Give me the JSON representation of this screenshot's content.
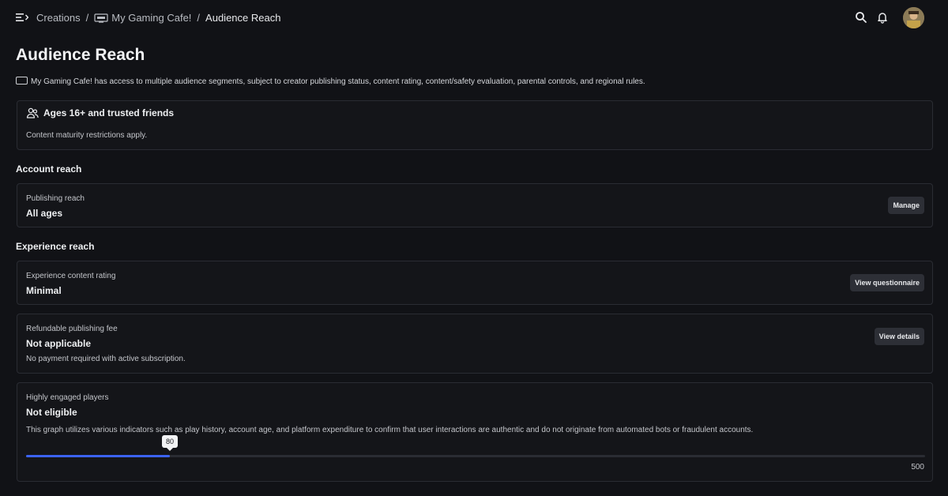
{
  "breadcrumb": {
    "items": [
      "Creations",
      "My Gaming Cafe!",
      "Audience Reach"
    ],
    "separator": "/"
  },
  "page": {
    "title": "Audience Reach",
    "intro": "My Gaming Cafe! has access to multiple audience segments, subject to creator publishing status, content rating, content/safety evaluation, parental controls, and regional rules."
  },
  "audience": {
    "title": "Ages 16+ and trusted friends",
    "note": "Content maturity restrictions apply."
  },
  "account_reach": {
    "heading": "Account reach",
    "publishing": {
      "label": "Publishing reach",
      "value": "All ages",
      "button": "Manage"
    }
  },
  "experience_reach": {
    "heading": "Experience reach",
    "content_rating": {
      "label": "Experience content rating",
      "value": "Minimal",
      "button": "View questionnaire"
    },
    "publishing_fee": {
      "label": "Refundable publishing fee",
      "value": "Not applicable",
      "note": "No payment required with active subscription.",
      "button": "View details"
    },
    "engaged_players": {
      "label": "Highly engaged players",
      "value": "Not eligible",
      "note": "This graph utilizes various indicators such as play history, account age, and platform expenditure to confirm that user interactions are authentic and do not originate from automated bots or fraudulent accounts.",
      "progress_value": "80",
      "progress_max": "500"
    }
  },
  "icons": [
    "menu-collapse-icon",
    "search-icon",
    "bell-icon",
    "avatar",
    "monitor-icon",
    "users-icon"
  ],
  "colors": {
    "background": "#111216",
    "card": "#141519",
    "accent": "#3b63f5"
  }
}
